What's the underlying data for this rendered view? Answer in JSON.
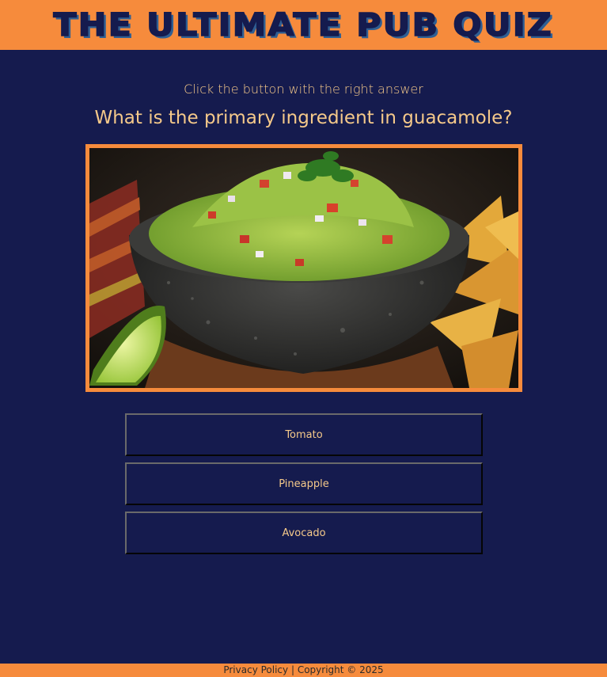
{
  "header": {
    "title": "THE ULTIMATE PUB QUIZ"
  },
  "quiz": {
    "instruction": "Click the button with the right answer",
    "question": "What is the primary ingredient in guacamole?",
    "answers": [
      {
        "label": "Tomato"
      },
      {
        "label": "Pineapple"
      },
      {
        "label": "Avocado"
      }
    ]
  },
  "footer": {
    "privacy_label": "Privacy Policy",
    "separator": "|",
    "copyright": "Copyright © 2025"
  },
  "colors": {
    "background": "#151b4e",
    "accent": "#f68b3c",
    "text": "#f5c98a"
  }
}
